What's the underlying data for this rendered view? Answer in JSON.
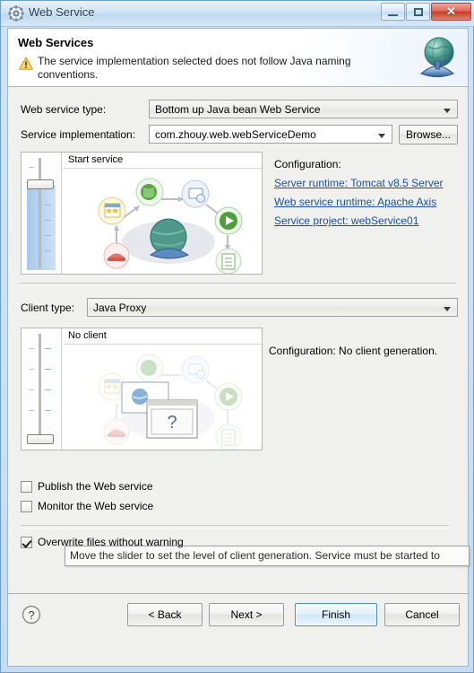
{
  "window": {
    "title": "Web Service",
    "icon": "gear-icon",
    "controls": {
      "minimize": "Minimize",
      "maximize": "Maximize",
      "close": "Close"
    }
  },
  "header": {
    "title": "Web Services",
    "warning_icon": "warning-icon",
    "message": "The service implementation selected does not follow Java naming conventions.",
    "banner_icon": "web-service-globe-icon"
  },
  "form": {
    "service_type_label": "Web service type:",
    "service_type_value": "Bottom up Java bean Web Service",
    "service_impl_label": "Service implementation:",
    "service_impl_value": "com.zhouy.web.webServiceDemo",
    "browse_label": "Browse..."
  },
  "service_panel": {
    "stage_label": "Start service",
    "configuration_title": "Configuration:",
    "links": [
      "Server runtime: Tomcat v8.5 Server",
      "Web service runtime: Apache Axis",
      "Service project: webService01"
    ]
  },
  "client_section": {
    "client_type_label": "Client type:",
    "client_type_value": "Java Proxy",
    "stage_label": "No client",
    "configuration_text": "Configuration: No client generation."
  },
  "tooltip": {
    "text": "Move the slider to set the level of client generation. Service must be started to"
  },
  "options": [
    {
      "label": "Publish the Web service",
      "checked": false
    },
    {
      "label": "Monitor the Web service",
      "checked": false
    },
    {
      "label": "Overwrite files without warning",
      "checked": true
    }
  ],
  "buttons": {
    "help": "?",
    "back": "< Back",
    "next": "Next >",
    "finish": "Finish",
    "cancel": "Cancel"
  },
  "colors": {
    "link": "#1a4f9c",
    "default_button_border": "#4a90c0",
    "warning": "#f0b429",
    "close_button": "#c83c26"
  }
}
